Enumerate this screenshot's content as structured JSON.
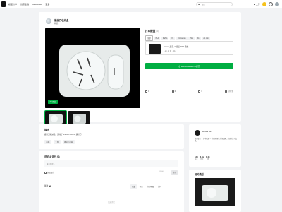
{
  "nav": {
    "items": [
      "模型分享",
      "创意集锦",
      "MakerLab",
      "更多"
    ],
    "search_placeholder": "搜索",
    "upload_label": "上传"
  },
  "model": {
    "title": "螺丝刀收纳盒",
    "subtitle": "精选",
    "badge_3d": "3D 预览"
  },
  "print_profile": {
    "header": "打印配置",
    "count": "(3)",
    "filters": [
      "全部",
      "PLA",
      "PETG",
      "X1",
      "X1-Carbon",
      "P1S",
      "A1",
      "A1 mini"
    ],
    "profile": {
      "name": "0.2mm 层高, 2 墙层, 15% 填充",
      "meta": "1.2h · 1 盘 · 32 g"
    },
    "open_button": "在 Bambu Studio 中打开",
    "actions": [
      {
        "icon": "like-icon",
        "value": "0"
      },
      {
        "icon": "collect-icon",
        "value": "0"
      },
      {
        "icon": "comment-icon",
        "value": "0"
      },
      {
        "icon": "share-icon",
        "value": "分享到"
      }
    ]
  },
  "description": {
    "title": "描述",
    "text": "螺丝刀收纳盒，适用于 15mm×150mm 螺丝刀",
    "tags": [
      "收纳",
      "工具",
      "螺丝刀收纳"
    ]
  },
  "comments": {
    "title": "评论 & 评分 (0)",
    "input_placeholder": "发表评论...",
    "image_upload_label": "添加图片",
    "char_count": "0/1000",
    "post_button": "发布",
    "sort_label": "最新",
    "tabs": [
      "全部",
      "评论",
      "打印晒图",
      "提问"
    ],
    "empty_text": "暂无评论"
  },
  "author": {
    "name": "Bambu Lab",
    "bio": "官方账号 — 分享优质 3D 打印模型与打印配置，欢迎关注与交流。",
    "stats": [
      {
        "value": "126",
        "label": "关注"
      },
      {
        "value": "2.1k",
        "label": "粉丝"
      },
      {
        "value": "8.4k",
        "label": "获赞"
      }
    ]
  },
  "related": {
    "title": "相关模型"
  },
  "colors": {
    "accent": "#00ae42",
    "background": "#f2f3f5"
  }
}
